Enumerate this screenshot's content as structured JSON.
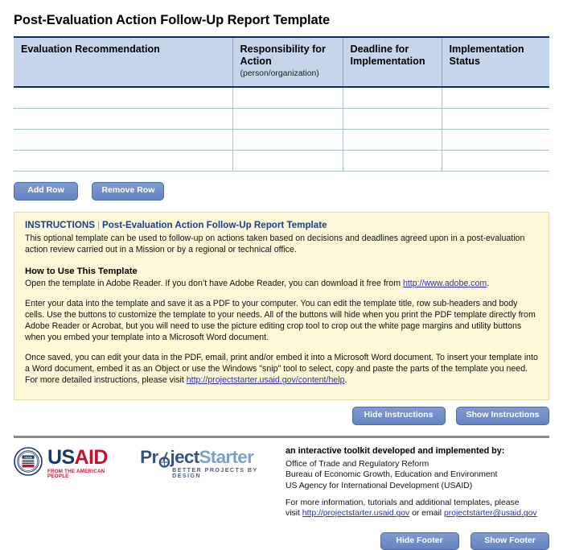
{
  "document": {
    "title": "Post-Evaluation Action Follow-Up Report Template"
  },
  "table": {
    "columns": [
      {
        "label": "Evaluation Recommendation",
        "sub": ""
      },
      {
        "label": "Responsibility for Action",
        "sub": "(person/organization)"
      },
      {
        "label": "Deadline for Implementation",
        "sub": ""
      },
      {
        "label": "Implementation Status",
        "sub": ""
      }
    ],
    "rows": [
      {
        "c0": "",
        "c1": "",
        "c2": "",
        "c3": ""
      },
      {
        "c0": "",
        "c1": "",
        "c2": "",
        "c3": ""
      },
      {
        "c0": "",
        "c1": "",
        "c2": "",
        "c3": ""
      },
      {
        "c0": "",
        "c1": "",
        "c2": "",
        "c3": ""
      }
    ],
    "add_row_label": "Add Row",
    "remove_row_label": "Remove Row"
  },
  "instructions": {
    "heading_label": "INSTRUCTIONS",
    "heading_divider": "|",
    "heading_title": "Post-Evaluation Action Follow-Up Report Template",
    "intro": "This optional template can be used to follow-up on actions taken based on decisions and deadlines agreed upon in a post-evaluation action review carried out in a Mission or by a regional or technical office.",
    "how_to_heading": "How to Use This Template",
    "para1_before_link": "Open the template in Adobe Reader. If you don’t have Adobe Reader, you can download it free from ",
    "para1_link": "http://www.adobe.com",
    "para1_after_link": ".",
    "para2": "Enter your data into the template and save it as a PDF to your computer. You can edit the template title, row sub-headers and body cells. Use the buttons to customize the template to your needs. All of the buttons will hide when you print the PDF template directly from Adobe Reader or Acrobat, but you will need to use the picture editing crop tool to crop out the white page margins and utility buttons when you embed your template into a Microsoft Word document.",
    "para3_before_link": "Once saved, you can edit your data in the PDF, email, print and/or embed it into a Microsoft Word document. To insert your template into a Word document, embed it as an Object or use the Windows \"snip\" tool to select, copy and paste the parts of the template you need. For more detailed instructions, please visit ",
    "para3_link": "http://projectstarter.usaid.gov/content/help",
    "para3_after_link": ".",
    "hide_label": "Hide Instructions",
    "show_label": "Show Instructions"
  },
  "footer": {
    "usaid_logo": {
      "word_part1": "US",
      "word_part2": "AID",
      "tagline": "FROM THE AMERICAN PEOPLE",
      "seal_text": "USAID"
    },
    "projectstarter_logo": {
      "word_part1": "Pr",
      "word_part1b": "ject",
      "word_part2": "Starter",
      "tagline": "BETTER PROJECTS BY DESIGN"
    },
    "heading": "an interactive toolkit developed and implemented by:",
    "org_lines": [
      "Office of Trade and Regulatory Reform",
      "Bureau of Economic Growth, Education and Environment",
      "US Agency for International Development (USAID)"
    ],
    "contact_line1": "For more information, tutorials and additional templates, please",
    "contact_visit_prefix": "visit ",
    "contact_url": "http://projectstarter.usaid.gov",
    "contact_or_email": " or email ",
    "contact_email": "projectstarter@usaid.gov",
    "hide_label": "Hide Footer",
    "show_label": "Show Footer"
  },
  "colors": {
    "header_fill": "#c6d6ea",
    "header_border": "#15256b",
    "button_blue": "#6f8fc8",
    "instructions_bg": "#fdf8d7",
    "link_blue": "#2b2bc4",
    "usaid_navy": "#17376e",
    "usaid_red": "#c8102e"
  }
}
